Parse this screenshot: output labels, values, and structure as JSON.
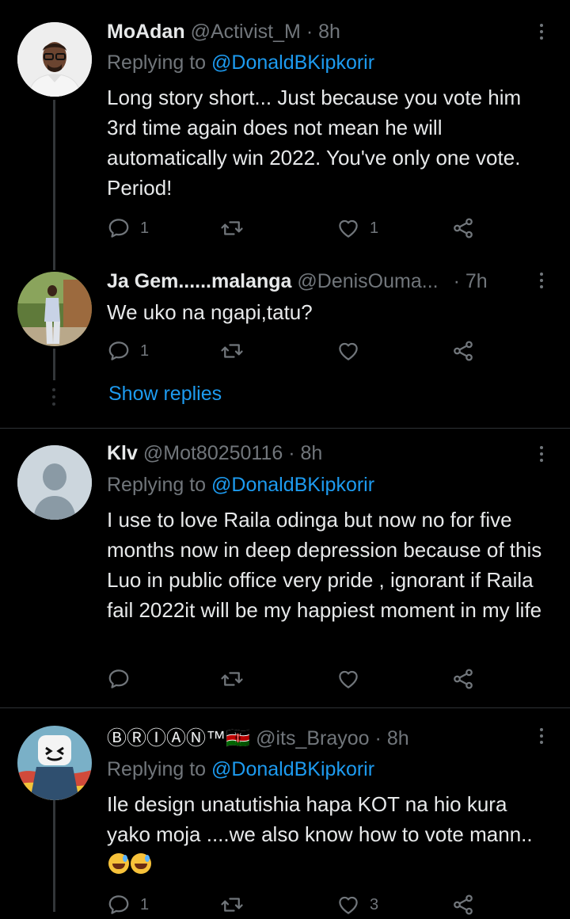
{
  "tweets": [
    {
      "name": "MoAdan",
      "handle": "@Activist_M",
      "sep": "·",
      "time": "8h",
      "replying_prefix": "Replying to ",
      "replying_to": "@DonaldBKipkorir",
      "text": "Long story short... Just because you vote him 3rd time again does not mean he will automatically win 2022. You've only one vote. Period!",
      "replies": "1",
      "retweets": "",
      "likes": "1"
    },
    {
      "name": "Ja Gem......malanga",
      "handle": "@DenisOuma...",
      "sep": "·",
      "time": "7h",
      "text": "We uko na ngapi,tatu?",
      "replies": "1",
      "retweets": "",
      "likes": ""
    },
    {
      "name": "Klv",
      "handle": "@Mot80250116",
      "sep": "·",
      "time": "8h",
      "replying_prefix": "Replying to ",
      "replying_to": "@DonaldBKipkorir",
      "text": "I use to love Raila odinga but now no for five months now in deep depression because of this Luo in public office very pride , ignorant if Raila fail 2022it will be my happiest moment in my life",
      "replies": "",
      "retweets": "",
      "likes": ""
    },
    {
      "name": "ⒷⓇⒾⒶⓃ™🇰🇪",
      "handle": "@its_Brayoo",
      "sep": "·",
      "time": "8h",
      "replying_prefix": "Replying to ",
      "replying_to": "@DonaldBKipkorir",
      "text": "Ile design unatutishia hapa KOT na hio kura yako moja ....we also know how to vote mann..",
      "replies": "1",
      "retweets": "",
      "likes": "3"
    }
  ],
  "show_replies": "Show replies",
  "icons": {
    "reply": "reply-icon",
    "retweet": "retweet-icon",
    "like": "heart-icon",
    "share": "share-icon",
    "more": "more-options-icon"
  },
  "colors": {
    "background": "#000000",
    "text": "#e7e9ea",
    "muted": "#71767b",
    "link": "#1d9bf0",
    "divider": "#2f3336"
  }
}
